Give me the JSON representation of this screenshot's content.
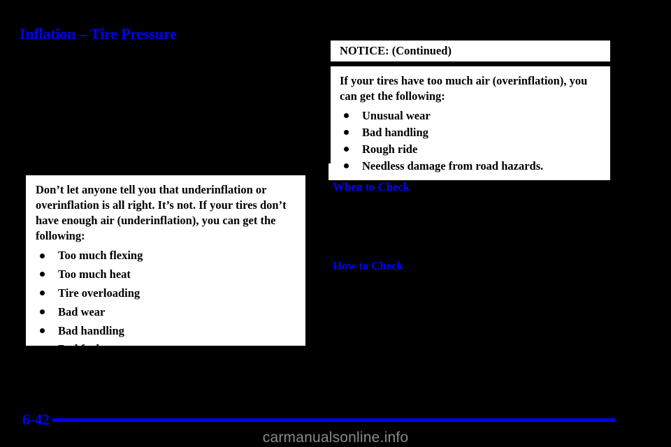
{
  "page": {
    "background_color": "#000000",
    "accent_color": "#0000ff",
    "page_number": "6-42",
    "watermark": "carmanualsonline.info"
  },
  "headings": {
    "main": "Inflation – Tire Pressure",
    "when_to_check": "When to Check",
    "how_to_check": "How to Check"
  },
  "notice_left": {
    "paragraph": "Don’t let anyone tell you that underinflation or overinflation is all right. It’s not. If your tires don’t have enough air (underinflation), you can get the following:",
    "bullets": [
      "Too much flexing",
      "Too much heat",
      "Tire overloading",
      "Bad wear",
      "Bad handling",
      "Bad fuel economy."
    ],
    "continued_label": "NOTICE: (Continued)"
  },
  "notice_right": {
    "header": "NOTICE: (Continued)",
    "paragraph": "If your tires have too much air (overinflation), you can get the following:",
    "bullets": [
      "Unusual wear",
      "Bad handling",
      "Rough ride",
      "Needless damage from road hazards."
    ]
  }
}
